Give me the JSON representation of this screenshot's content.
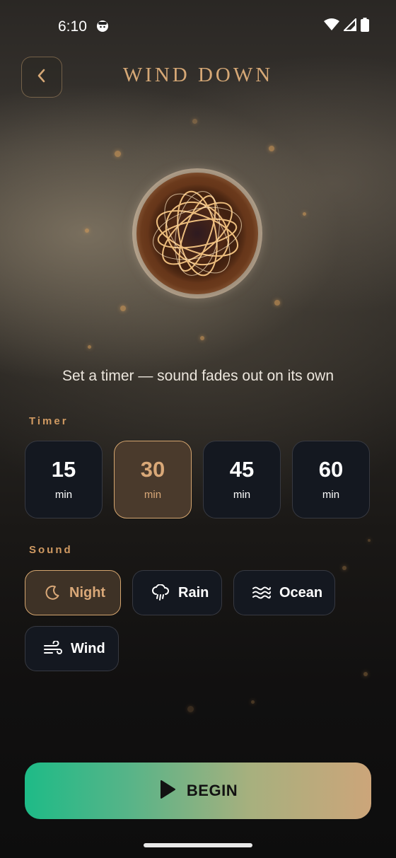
{
  "status_bar": {
    "time": "6:10"
  },
  "header": {
    "title": "WIND DOWN",
    "back_icon": "chevron-left-icon"
  },
  "subtitle": "Set a timer — sound fades out on its own",
  "timer": {
    "label": "Timer",
    "options": [
      {
        "value": "15",
        "unit": "min",
        "selected": false
      },
      {
        "value": "30",
        "unit": "min",
        "selected": true
      },
      {
        "value": "45",
        "unit": "min",
        "selected": false
      },
      {
        "value": "60",
        "unit": "min",
        "selected": false
      }
    ]
  },
  "sound": {
    "label": "Sound",
    "options": [
      {
        "label": "Night",
        "icon": "moon-icon",
        "selected": true
      },
      {
        "label": "Rain",
        "icon": "rain-cloud-icon",
        "selected": false
      },
      {
        "label": "Ocean",
        "icon": "waves-icon",
        "selected": false
      },
      {
        "label": "Wind",
        "icon": "wind-icon",
        "selected": false
      }
    ]
  },
  "begin_button": {
    "label": "BEGIN",
    "icon": "play-icon"
  },
  "colors": {
    "accent_gold": "#d6a876",
    "button_gradient_start": "#1ebb87",
    "button_gradient_end": "#cca57a",
    "card_bg": "#141820"
  }
}
